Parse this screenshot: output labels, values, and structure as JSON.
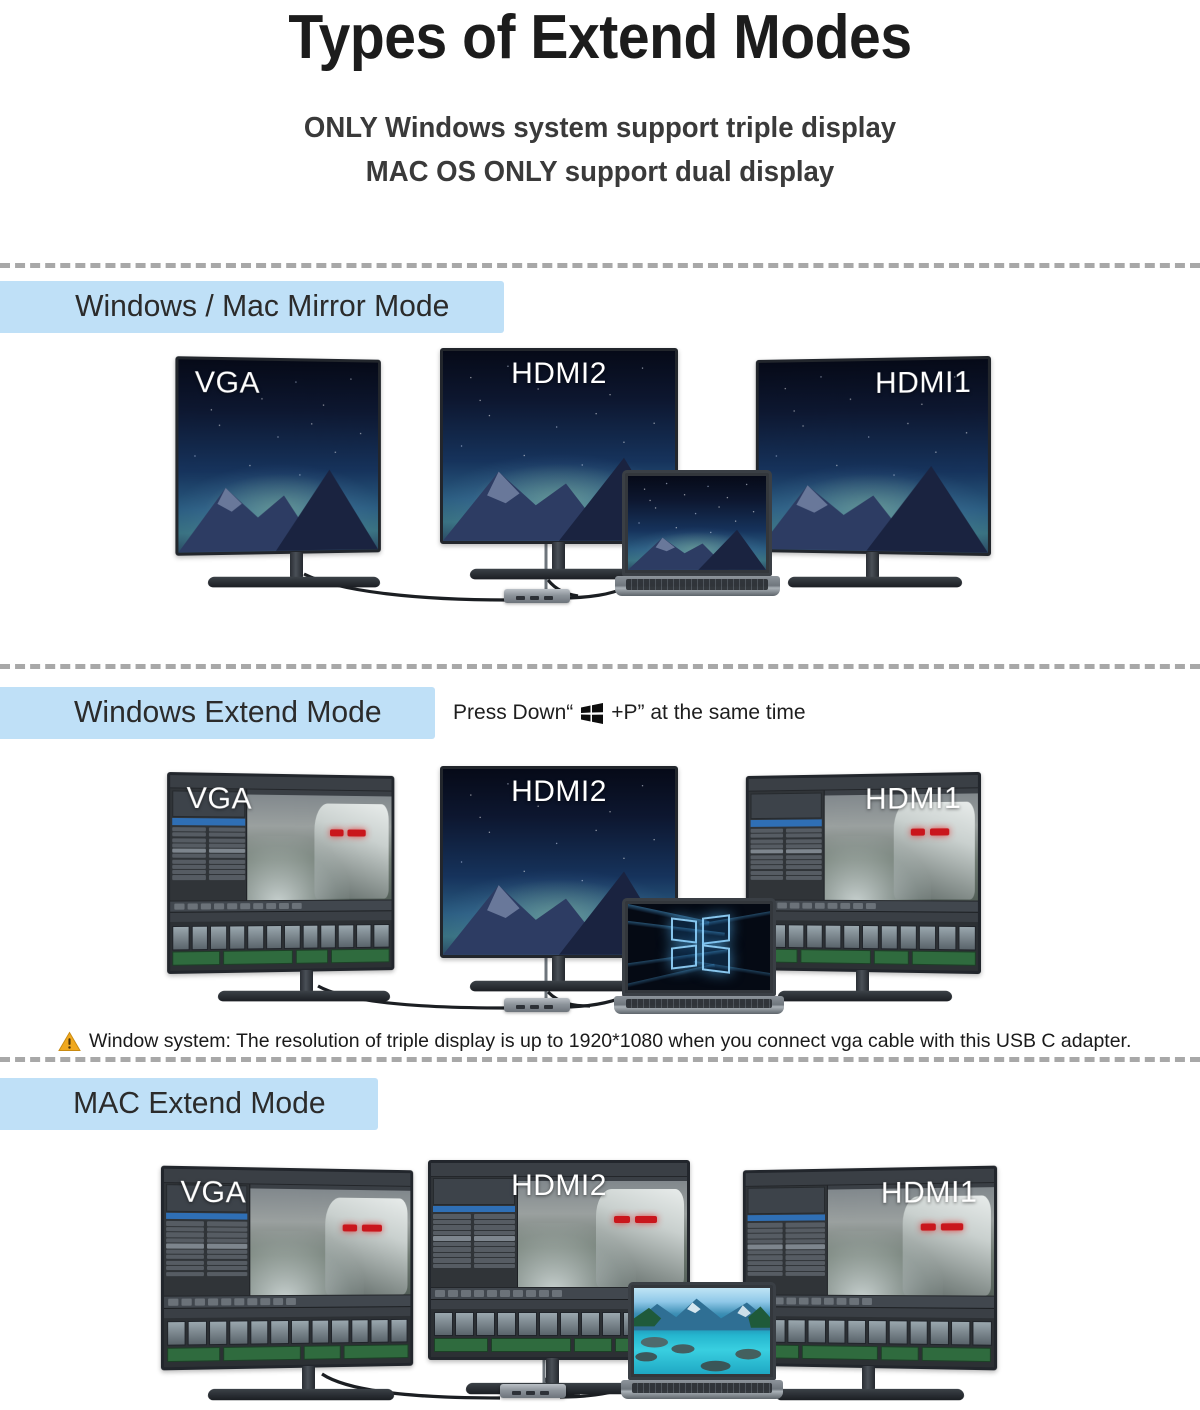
{
  "header": {
    "title": "Types of Extend Modes",
    "subtitle_line1": "ONLY Windows system support triple display",
    "subtitle_line2": "MAC OS ONLY support dual display"
  },
  "colors": {
    "badge_bg": "#bfe0f7",
    "divider": "#a8a8a8",
    "title_text": "#1c1c1c",
    "warning": "#f0a81e"
  },
  "sections": [
    {
      "id": "mirror",
      "badge_label": "Windows / Mac Mirror Mode",
      "monitors": [
        {
          "label": "VGA",
          "align": "left",
          "wallpaper": "night-mountain"
        },
        {
          "label": "HDMI2",
          "align": "center",
          "wallpaper": "night-mountain"
        },
        {
          "label": "HDMI1",
          "align": "right",
          "wallpaper": "night-mountain"
        }
      ],
      "laptop": {
        "wallpaper": "night-mountain"
      }
    },
    {
      "id": "windows-extend",
      "badge_label": "Windows Extend Mode",
      "press_prefix": "Press Down“",
      "press_key_icon": "windows-logo-icon",
      "press_suffix": "+P” at the same time",
      "monitors": [
        {
          "label": "VGA",
          "align": "left",
          "wallpaper": "video-editor"
        },
        {
          "label": "HDMI2",
          "align": "center",
          "wallpaper": "night-mountain"
        },
        {
          "label": "HDMI1",
          "align": "right",
          "wallpaper": "video-editor"
        }
      ],
      "laptop": {
        "wallpaper": "windows-10-hero"
      },
      "note": "Window system: The resolution of triple display  is up to  1920*1080 when you connect vga cable with this USB C adapter."
    },
    {
      "id": "mac-extend",
      "badge_label": "MAC Extend Mode",
      "monitors": [
        {
          "label": "VGA",
          "align": "left",
          "wallpaper": "video-editor"
        },
        {
          "label": "HDMI2",
          "align": "center",
          "wallpaper": "video-editor"
        },
        {
          "label": "HDMI1",
          "align": "right",
          "wallpaper": "video-editor"
        }
      ],
      "laptop": {
        "wallpaper": "turquoise-river"
      }
    }
  ]
}
